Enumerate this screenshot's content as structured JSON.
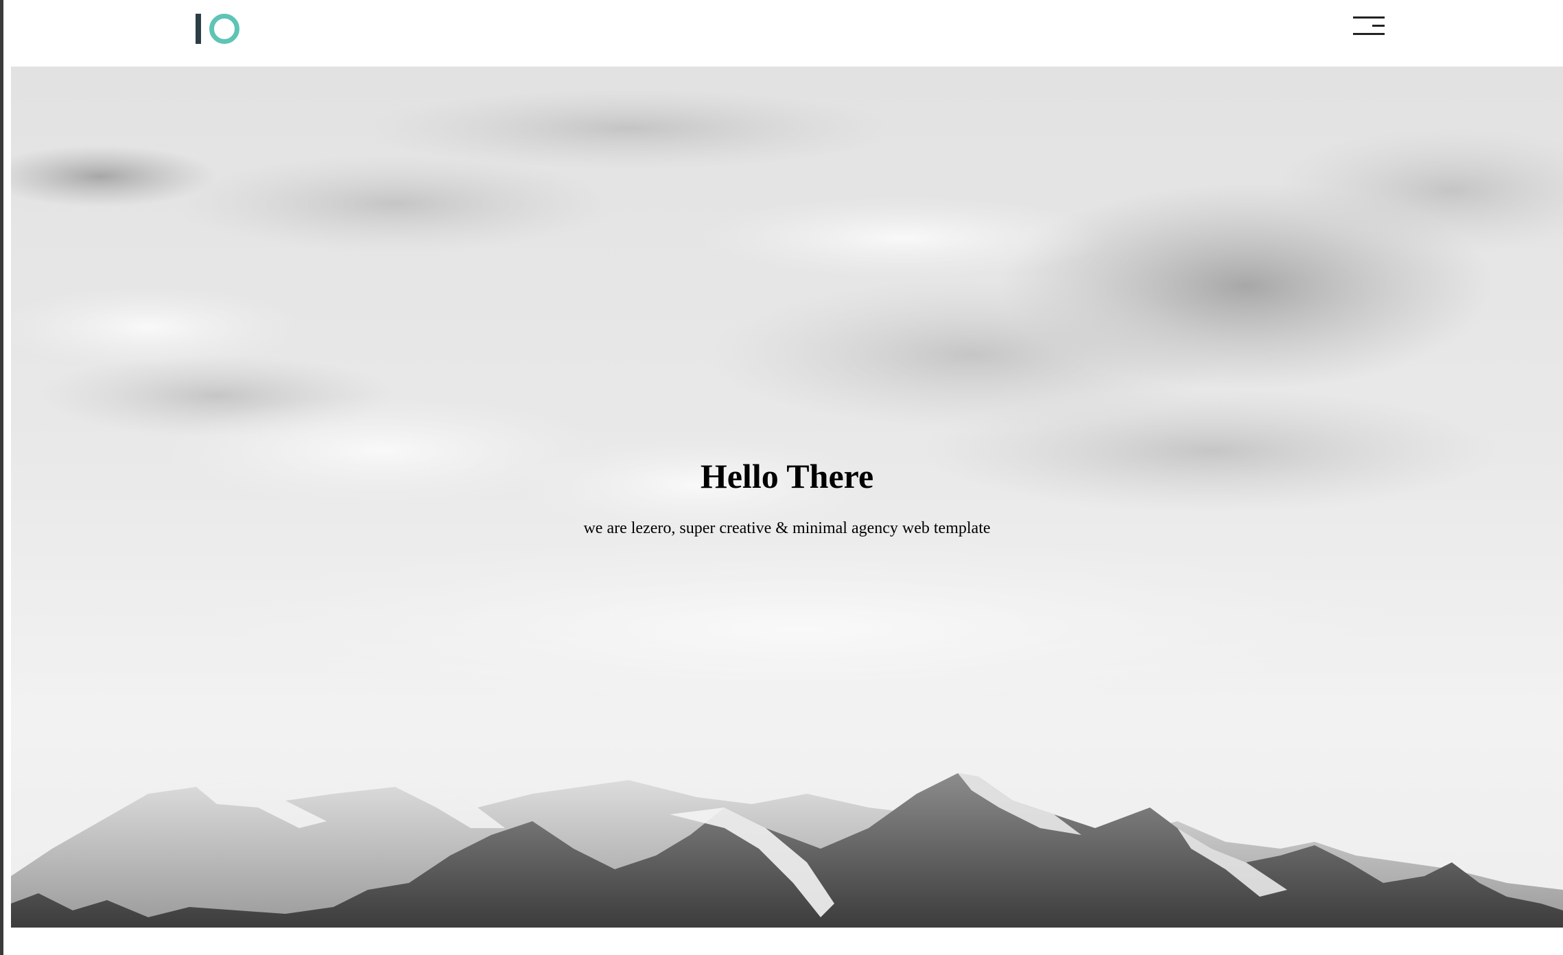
{
  "header": {
    "logo_icon": "io-logo-icon",
    "menu_icon": "hamburger-menu-icon"
  },
  "hero": {
    "title": "Hello There",
    "subtitle": "we are lezero, super creative & minimal agency web template",
    "background": "grayscale-mountain-clouds"
  },
  "colors": {
    "logo_bar": "#2c3e45",
    "logo_ring": "#5ec4b6",
    "text": "#000000",
    "background": "#ffffff"
  }
}
